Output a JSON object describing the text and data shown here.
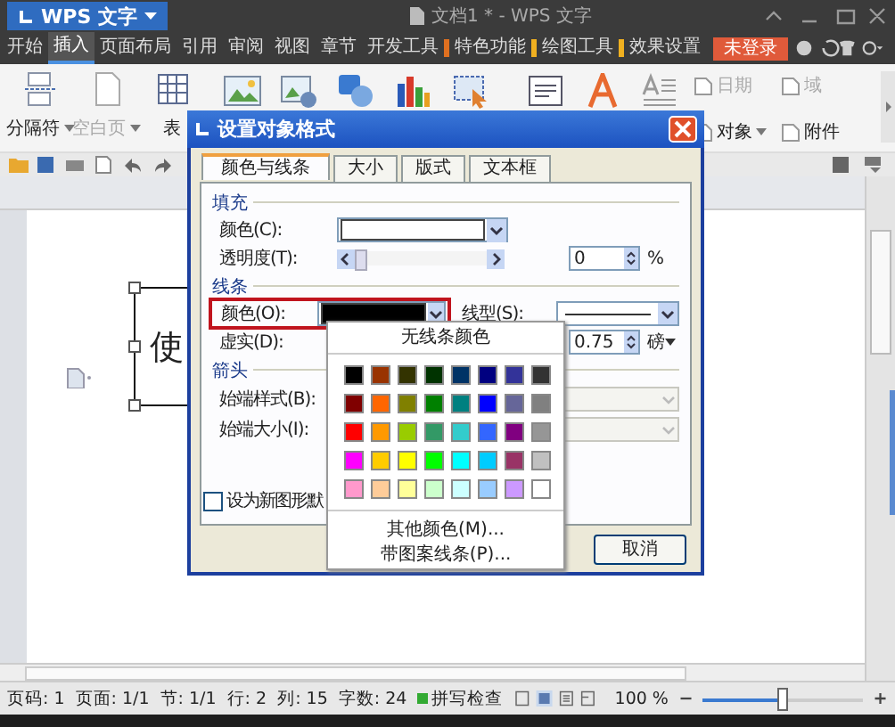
{
  "app": {
    "logo": "WPS 文字",
    "title": "文档1 * - WPS 文字"
  },
  "menu": [
    {
      "label": "开始",
      "selected": false
    },
    {
      "label": "插入",
      "selected": true
    },
    {
      "label": "页面布局",
      "selected": false
    },
    {
      "label": "引用",
      "selected": false
    },
    {
      "label": "审阅",
      "selected": false
    },
    {
      "label": "视图",
      "selected": false
    },
    {
      "label": "章节",
      "selected": false
    },
    {
      "label": "开发工具",
      "selected": false
    },
    {
      "label": "特色功能",
      "selected": false,
      "color": "#e07020"
    },
    {
      "label": "绘图工具",
      "selected": false,
      "color": "#f0b020"
    },
    {
      "label": "效果设置",
      "selected": false,
      "color": "#f0b020"
    }
  ],
  "login": "未登录",
  "ribbon": {
    "left": [
      {
        "label": "分隔符",
        "dropdown": true,
        "disabled": false
      },
      {
        "label": "空白页",
        "dropdown": true,
        "disabled": true
      },
      {
        "label": "表",
        "dropdown": false,
        "disabled": false
      }
    ],
    "right": [
      {
        "label": "日期",
        "dropdown": false,
        "disabled": true
      },
      {
        "label": "域",
        "dropdown": false,
        "disabled": true
      },
      {
        "label": "对象",
        "dropdown": true,
        "disabled": false
      },
      {
        "label": "附件",
        "dropdown": false,
        "disabled": false
      }
    ]
  },
  "document": {
    "textbox_text": "使"
  },
  "dialog": {
    "title": "设置对象格式",
    "tabs": [
      {
        "label": "颜色与线条",
        "selected": true
      },
      {
        "label": "大小",
        "selected": false
      },
      {
        "label": "版式",
        "selected": false
      },
      {
        "label": "文本框",
        "selected": false
      }
    ],
    "fill": {
      "heading": "填充",
      "color_label": "颜色(C):",
      "color": "#ffffff",
      "transparency_label": "透明度(T):",
      "transparency": {
        "level": 0
      },
      "transparency_value": "0",
      "percent": "%"
    },
    "line": {
      "heading": "线条",
      "color_label": "颜色(O):",
      "color": "#000000",
      "highlighted": true,
      "style_label": "线型(S):",
      "dash_label": "虚实(D):",
      "weight_value": "0.75",
      "weight_unit": "磅"
    },
    "arrows": {
      "heading": "箭头",
      "begin_style_label": "始端样式(B):",
      "begin_size_label": "始端大小(I):",
      "disabled": true
    },
    "default_checkbox": {
      "label": "设为新图形默",
      "checked": false
    },
    "cancel": "取消",
    "color_menu": {
      "no_color": "无线条颜色",
      "more_colors": "其他颜色(M)...",
      "patterned": "带图案线条(P)...",
      "swatches": [
        {
          "color": "#000000"
        },
        {
          "color": "#993300"
        },
        {
          "color": "#333300"
        },
        {
          "color": "#003300"
        },
        {
          "color": "#003366"
        },
        {
          "color": "#000080"
        },
        {
          "color": "#333399"
        },
        {
          "color": "#333333"
        },
        {
          "color": "#800000"
        },
        {
          "color": "#ff6600"
        },
        {
          "color": "#808000"
        },
        {
          "color": "#008000"
        },
        {
          "color": "#008080"
        },
        {
          "color": "#0000ff"
        },
        {
          "color": "#666699"
        },
        {
          "color": "#808080"
        },
        {
          "color": "#ff0000"
        },
        {
          "color": "#ff9900"
        },
        {
          "color": "#99cc00"
        },
        {
          "color": "#339966"
        },
        {
          "color": "#33cccc"
        },
        {
          "color": "#3366ff"
        },
        {
          "color": "#800080"
        },
        {
          "color": "#969696"
        },
        {
          "color": "#ff00ff"
        },
        {
          "color": "#ffcc00"
        },
        {
          "color": "#ffff00"
        },
        {
          "color": "#00ff00"
        },
        {
          "color": "#00ffff"
        },
        {
          "color": "#00ccff"
        },
        {
          "color": "#993366"
        },
        {
          "color": "#c0c0c0"
        },
        {
          "color": "#ff99cc"
        },
        {
          "color": "#ffcc99"
        },
        {
          "color": "#ffff99"
        },
        {
          "color": "#ccffcc"
        },
        {
          "color": "#ccffff"
        },
        {
          "color": "#99ccff"
        },
        {
          "color": "#cc99ff"
        },
        {
          "color": "#ffffff"
        }
      ]
    }
  },
  "status_bar": {
    "items": [
      "页码: 1",
      "页面: 1/1",
      "节: 1/1",
      "行: 2",
      "列: 15",
      "字数: 24"
    ],
    "spell_check": "拼写检查",
    "zoom": "100 %",
    "zoom_slider": {
      "level": 0.5
    }
  }
}
